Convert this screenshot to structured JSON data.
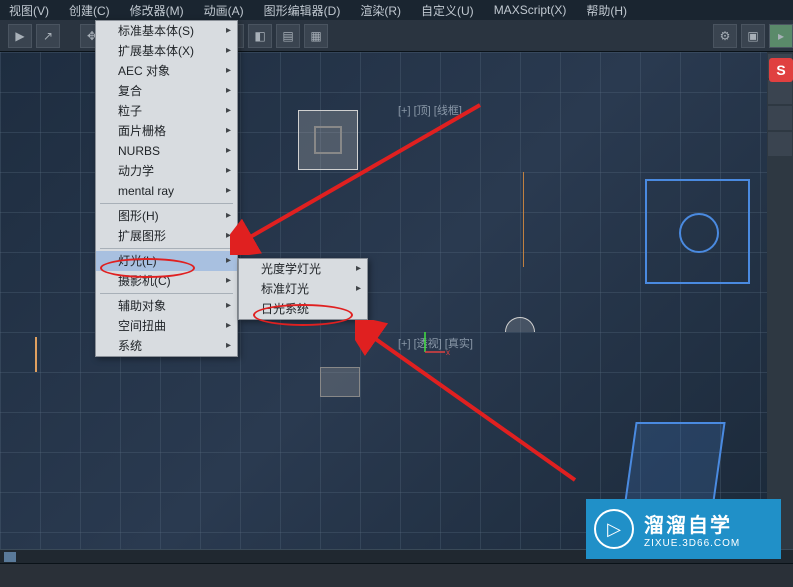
{
  "menubar": {
    "items": [
      "视图(V)",
      "创建(C)",
      "修改器(M)",
      "动画(A)",
      "图形编辑器(D)",
      "渲染(R)",
      "自定义(U)",
      "MAXScript(X)",
      "帮助(H)"
    ]
  },
  "dropdown": {
    "items": [
      {
        "label": "标准基本体(S)",
        "sub": true
      },
      {
        "label": "扩展基本体(X)",
        "sub": true
      },
      {
        "label": "AEC 对象",
        "sub": true
      },
      {
        "label": "复合",
        "sub": true
      },
      {
        "label": "粒子",
        "sub": true
      },
      {
        "label": "面片栅格",
        "sub": true
      },
      {
        "label": "NURBS",
        "sub": true
      },
      {
        "label": "动力学",
        "sub": true
      },
      {
        "label": "mental ray",
        "sub": true
      },
      {
        "sep": true
      },
      {
        "label": "图形(H)",
        "sub": true
      },
      {
        "label": "扩展图形",
        "sub": true
      },
      {
        "sep": true
      },
      {
        "label": "灯光(L)",
        "sub": true,
        "highlighted": true
      },
      {
        "label": "摄影机(C)",
        "sub": true
      },
      {
        "sep": true
      },
      {
        "label": "辅助对象",
        "sub": true
      },
      {
        "label": "空间扭曲",
        "sub": true
      },
      {
        "label": "系统",
        "sub": true
      }
    ]
  },
  "submenu": {
    "items": [
      {
        "label": "光度学灯光",
        "sub": true
      },
      {
        "label": "标准灯光",
        "sub": true
      },
      {
        "label": "日光系统",
        "sub": false,
        "highlighted": true
      }
    ]
  },
  "viewport": {
    "label_top": "[+] [顶] [线框]",
    "label_bottom": "[+] [透视] [真实]"
  },
  "watermark": {
    "title": "溜溜自学",
    "url": "ZIXUE.3D66.COM"
  },
  "badge": "S",
  "colors": {
    "annotation": "#e02020",
    "brand": "#2090c8"
  }
}
